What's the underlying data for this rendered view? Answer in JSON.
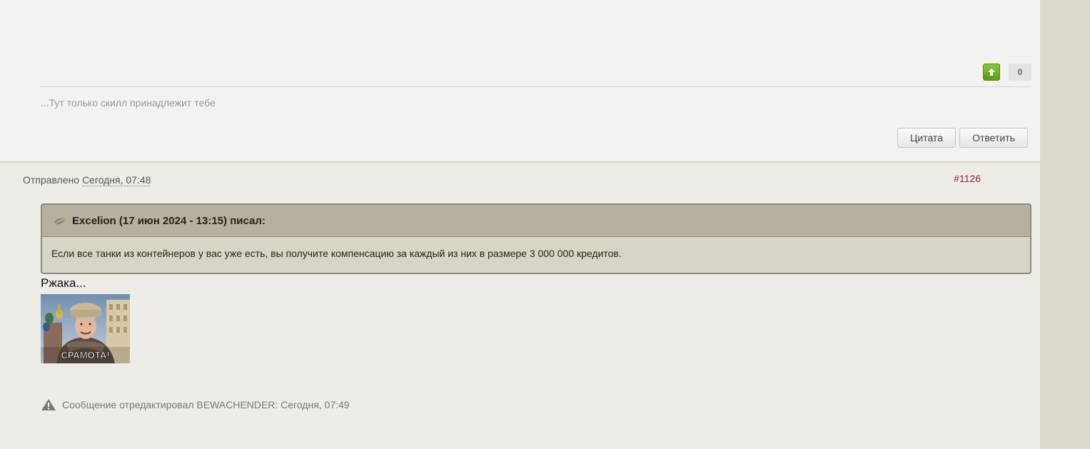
{
  "previous_post": {
    "reputation": {
      "up_icon": "arrow-up-icon",
      "count": "0"
    },
    "signature": "...Тут только скилл принадлежит тебе",
    "buttons": {
      "quote": "Цитата",
      "reply": "Ответить"
    }
  },
  "post": {
    "meta_prefix": "Отправлено",
    "date": "Сегодня, 07:48",
    "number": "#1126",
    "quote": {
      "icon": "quote-icon",
      "header": "Excelion (17 июн 2024 - 13:15) писал:",
      "text": "Если все танки из контейнеров у вас уже есть, вы получите компенсацию за каждый из них в размере 3 000 000 кредитов."
    },
    "text": "Ржака...",
    "image_caption": "СРАМОТА!",
    "edit_note": {
      "icon": "warning-icon",
      "text": "Сообщение отредактировал BEWACHENDER: Сегодня, 07:49"
    }
  },
  "colors": {
    "page_bg": "#edece7",
    "prev_post_bg": "#f2f2f2",
    "quote_header_bg": "#b5b0a0",
    "quote_body_bg": "#d7d5c5",
    "post_number": "#8b2a2a",
    "rep_up": "#6aaa1e"
  }
}
